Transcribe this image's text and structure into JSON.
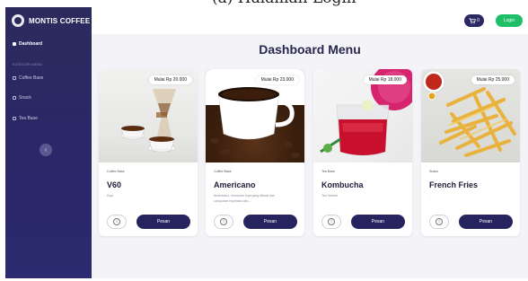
{
  "caption": "(a) Halaman Login",
  "brand": {
    "name": "MONTIS COFFEE"
  },
  "sidebar": {
    "dashboard": "Dashboard",
    "heading": "KATEGORI MENU",
    "items": [
      {
        "label": "Coffee Base"
      },
      {
        "label": "Snack"
      },
      {
        "label": "Tea Base"
      }
    ],
    "collapse_glyph": "‹"
  },
  "header": {
    "cart_count": "0",
    "login_label": "Login"
  },
  "main": {
    "title": "Dashboard Menu",
    "products": [
      {
        "category": "Coffee Base",
        "name": "V60",
        "description": "Kopi",
        "price": "Mulai Rp 20.000",
        "order_label": "Pesan"
      },
      {
        "category": "Coffee Base",
        "name": "Americano",
        "description": "Americano, minuman kopi yang dibuat dari campuran espresso dan...",
        "price": "Mulai Rp 23.000",
        "order_label": "Pesan"
      },
      {
        "category": "Tea Base",
        "name": "Kombucha",
        "description": "Tea Variant",
        "price": "Mulai Rp 18.000",
        "order_label": "Pesan"
      },
      {
        "category": "Snack",
        "name": "French Fries",
        "description": "-",
        "price": "Mulai Rp 25.000",
        "order_label": "Pesan"
      }
    ],
    "info_glyph": "i"
  },
  "colors": {
    "sidebar": "#2c2a5c",
    "accent": "#26245e",
    "login": "#1fbf6a"
  }
}
